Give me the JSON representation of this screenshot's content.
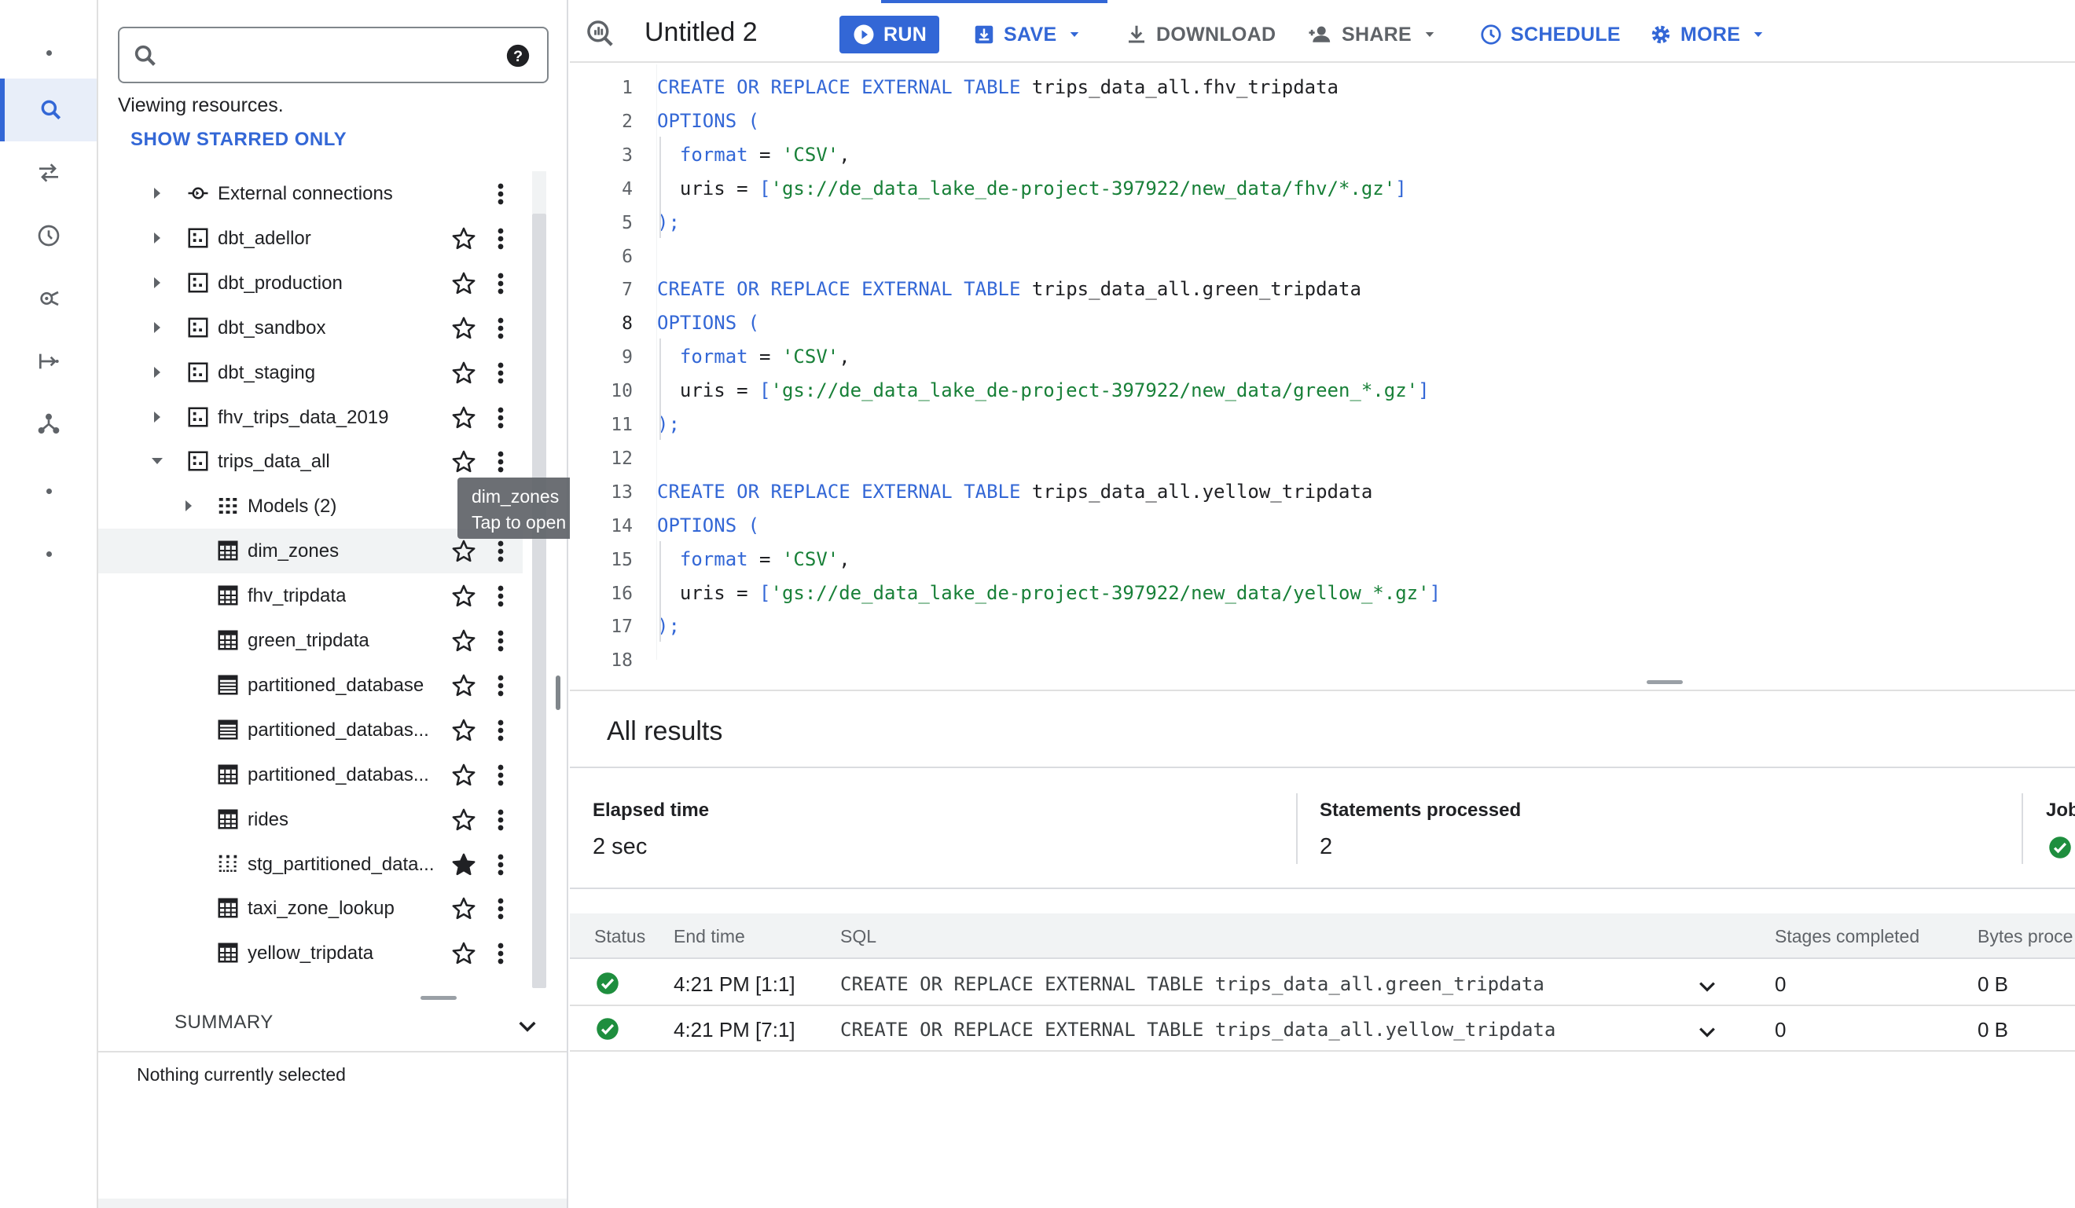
{
  "rail": {
    "items": [
      "dot",
      "search-icon",
      "transfer-icon",
      "history-icon",
      "analytics-hub-icon",
      "dataflow-icon",
      "graph-icon",
      "dot",
      "dot"
    ],
    "active_index": 1
  },
  "explorer": {
    "search": {
      "placeholder": "",
      "value": ""
    },
    "viewing_text": "Viewing resources.",
    "show_starred_label": "SHOW STARRED ONLY",
    "tree": [
      {
        "label": "External connections",
        "icon": "external-connection-icon",
        "expanded": false,
        "starred": null
      },
      {
        "label": "dbt_adellor",
        "icon": "dataset-icon",
        "expanded": false,
        "starred": false
      },
      {
        "label": "dbt_production",
        "icon": "dataset-icon",
        "expanded": false,
        "starred": false
      },
      {
        "label": "dbt_sandbox",
        "icon": "dataset-icon",
        "expanded": false,
        "starred": false
      },
      {
        "label": "dbt_staging",
        "icon": "dataset-icon",
        "expanded": false,
        "starred": false
      },
      {
        "label": "fhv_trips_data_2019",
        "icon": "dataset-icon",
        "expanded": false,
        "starred": false
      },
      {
        "label": "trips_data_all",
        "icon": "dataset-icon",
        "expanded": true,
        "starred": false
      },
      {
        "label": "Models (2)",
        "icon": "models-icon",
        "expanded": false,
        "starred": null
      },
      {
        "label": "dim_zones",
        "icon": "table-icon",
        "starred": false
      },
      {
        "label": "fhv_tripdata",
        "icon": "table-icon",
        "starred": false
      },
      {
        "label": "green_tripdata",
        "icon": "table-icon",
        "starred": false
      },
      {
        "label": "partitioned_database",
        "icon": "partitioned-table-icon",
        "starred": false
      },
      {
        "label": "partitioned_databas...",
        "icon": "partitioned-table-icon",
        "starred": false
      },
      {
        "label": "partitioned_databas...",
        "icon": "table-icon",
        "starred": false
      },
      {
        "label": "rides",
        "icon": "table-icon",
        "starred": false
      },
      {
        "label": "stg_partitioned_data...",
        "icon": "view-icon",
        "starred": true
      },
      {
        "label": "taxi_zone_lookup",
        "icon": "table-icon",
        "starred": false
      },
      {
        "label": "yellow_tripdata",
        "icon": "table-icon",
        "starred": false
      }
    ],
    "tooltip": {
      "title": "dim_zones",
      "hint": "Tap to open"
    },
    "summary_label": "SUMMARY",
    "summary_empty": "Nothing currently selected"
  },
  "toolbar": {
    "tab_title": "Untitled 2",
    "run": "RUN",
    "save": "SAVE",
    "download": "DOWNLOAD",
    "share": "SHARE",
    "schedule": "SCHEDULE",
    "more": "MORE"
  },
  "editor": {
    "current_line": 8,
    "lines": [
      "CREATE OR REPLACE EXTERNAL TABLE trips_data_all.fhv_tripdata",
      "OPTIONS (",
      "  format = 'CSV',",
      "  uris = ['gs://de_data_lake_de-project-397922/new_data/fhv/*.gz']",
      ");",
      "",
      "CREATE OR REPLACE EXTERNAL TABLE trips_data_all.green_tripdata",
      "OPTIONS (",
      "  format = 'CSV',",
      "  uris = ['gs://de_data_lake_de-project-397922/new_data/green_*.gz']",
      ");",
      "",
      "CREATE OR REPLACE EXTERNAL TABLE trips_data_all.yellow_tripdata",
      "OPTIONS (",
      "  format = 'CSV',",
      "  uris = ['gs://de_data_lake_de-project-397922/new_data/yellow_*.gz']",
      ");",
      ""
    ]
  },
  "results": {
    "title": "All results",
    "stats": [
      {
        "label": "Elapsed time",
        "value": "2 sec"
      },
      {
        "label": "Statements processed",
        "value": "2"
      },
      {
        "label": "Job",
        "value": ""
      }
    ],
    "columns": [
      "Status",
      "End time",
      "SQL",
      "Stages completed",
      "Bytes proce"
    ],
    "rows": [
      {
        "status": "success",
        "end_time": "4:21 PM [1:1]",
        "sql": "CREATE OR REPLACE EXTERNAL TABLE trips_data_all.green_tripdata",
        "stages": "0",
        "bytes": "0 B"
      },
      {
        "status": "success",
        "end_time": "4:21 PM [7:1]",
        "sql": "CREATE OR REPLACE EXTERNAL TABLE trips_data_all.yellow_tripdata",
        "stages": "0",
        "bytes": "0 B"
      }
    ]
  },
  "colors": {
    "accent": "#3367d6",
    "success": "#1e8e3e",
    "string": "#188038"
  }
}
